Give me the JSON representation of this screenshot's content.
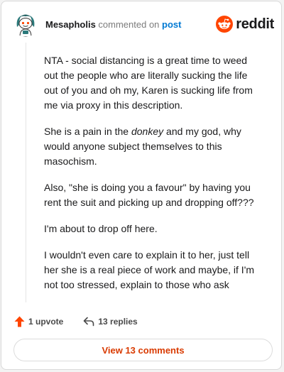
{
  "header": {
    "author": "Mesapholis",
    "action_text": "commented on",
    "post_link": "post",
    "logo_text": "reddit"
  },
  "comment": {
    "paragraphs": [
      [
        "NTA - social distancing is a great time to weed",
        "out the people who are literally sucking the life",
        "out of you and oh my, Karen is sucking life from",
        "me via proxy in this description."
      ],
      [
        "She is a pain in the ",
        "donkey",
        " and my god, why",
        "would anyone subject themselves to this",
        "masochism."
      ],
      [
        "Also, \"she is doing you a favour\" by having you",
        "rent the suit and picking up and dropping off???"
      ],
      [
        "I'm about to drop off here."
      ],
      [
        "I wouldn't even care to explain it to her, just tell",
        "her she is a real piece of work and maybe, if I'm",
        "not too stressed, explain to those who ask"
      ]
    ]
  },
  "actions": {
    "upvote_label": "1 upvote",
    "replies_label": "13 replies"
  },
  "footer": {
    "view_comments_label": "View 13 comments"
  },
  "colors": {
    "brand": "#ff4500",
    "link": "#0079d3",
    "view_button_text": "#d93a00"
  },
  "icons": {
    "avatar": "snoo-avatar-icon",
    "logo": "reddit-logo-icon",
    "upvote": "upvote-arrow-icon",
    "reply": "reply-arrow-icon"
  }
}
